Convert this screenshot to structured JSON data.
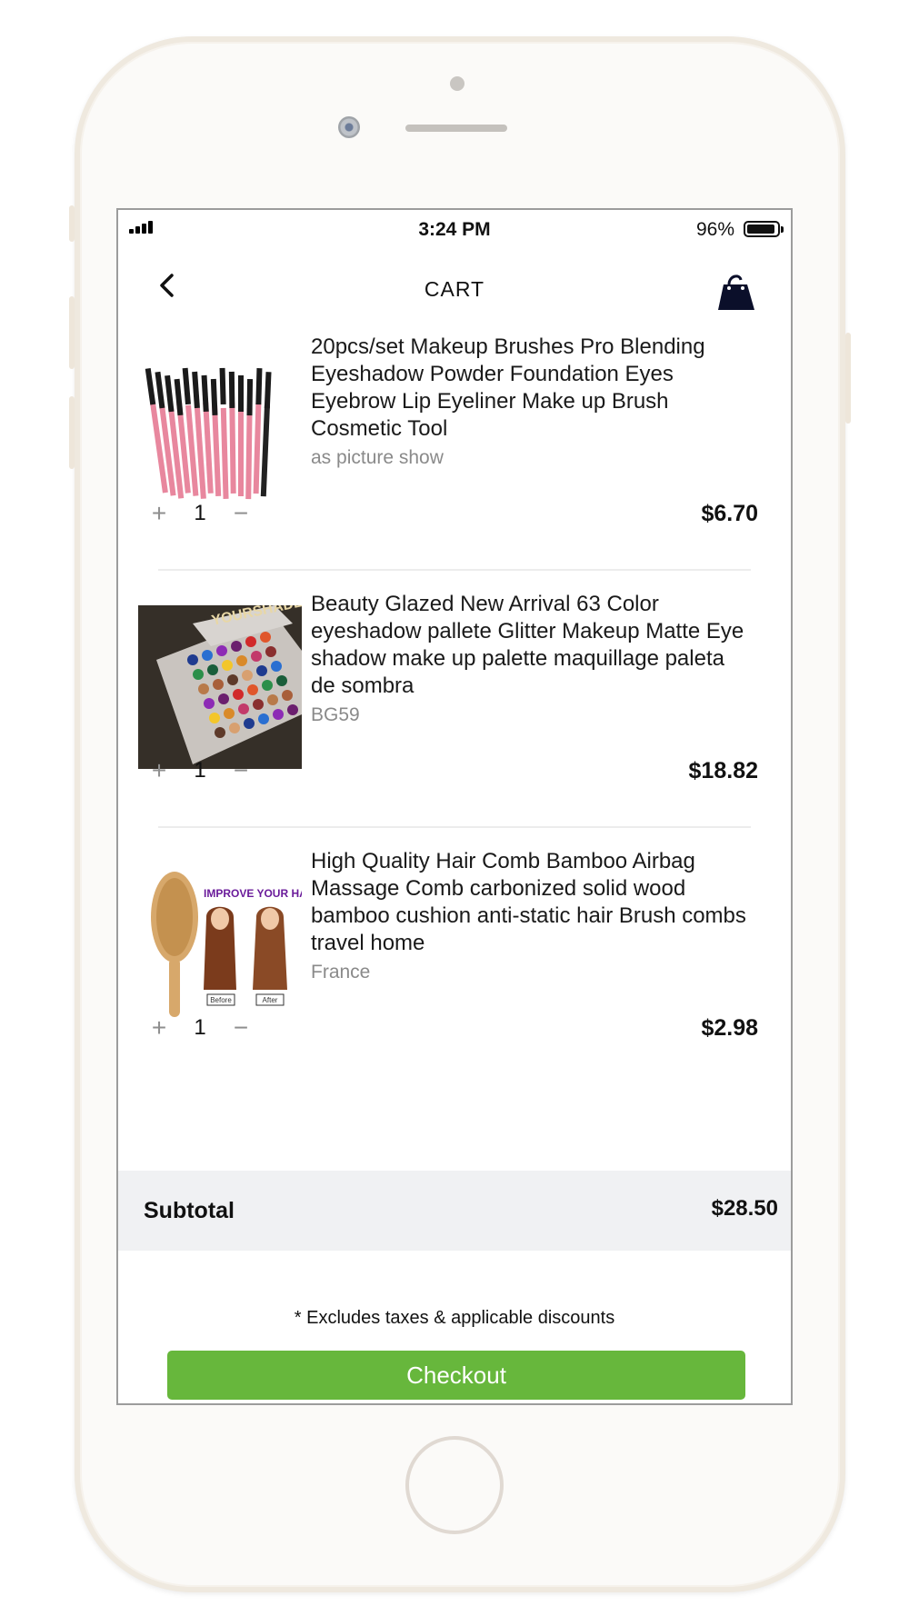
{
  "status_bar": {
    "time": "3:24 PM",
    "battery": "96%"
  },
  "nav": {
    "title": "CART",
    "back_icon": "chevron-left-icon",
    "bag_icon": "shopping-bag-icon"
  },
  "items": [
    {
      "title": "20pcs/set Makeup Brushes Pro Blending Eyeshadow Powder Foundation Eyes Eyebrow Lip Eyeliner Make up Brush Cosmetic Tool",
      "variant": "as picture show",
      "quantity": "1",
      "price": "$6.70"
    },
    {
      "title": "Beauty Glazed New Arrival 63 Color eyeshadow pallete Glitter Makeup Matte Eye shadow make up palette maquillage paleta de sombra",
      "variant": "BG59",
      "quantity": "1",
      "price": "$18.82",
      "image_text": "YOURSHADES"
    },
    {
      "title": "High Quality Hair Comb Bamboo Airbag Massage Comb carbonized solid wood bamboo cushion anti-static hair Brush combs travel home",
      "variant": "France",
      "quantity": "1",
      "price": "$2.98",
      "image_text": "IMPROVE YOUR HAIR",
      "image_before": "Before",
      "image_after": "After"
    }
  ],
  "quantity_controls": {
    "increase": "+",
    "decrease": "−"
  },
  "subtotal": {
    "label": "Subtotal",
    "value": "$28.50"
  },
  "note": "* Excludes taxes & applicable discounts",
  "checkout": {
    "label": "Checkout",
    "color": "#67b73c"
  }
}
